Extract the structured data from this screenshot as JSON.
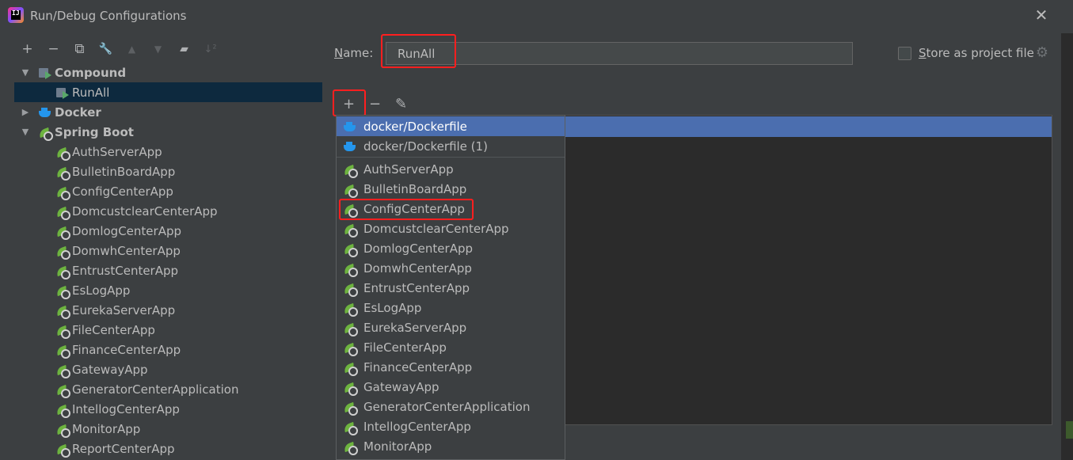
{
  "window": {
    "title": "Run/Debug Configurations"
  },
  "toolbar": {
    "add": "+",
    "remove": "−",
    "copy": "⧉",
    "edit": "🔧",
    "up": "▲",
    "down": "▼",
    "folder": "▰",
    "sort": "↓²"
  },
  "tree": {
    "groups": [
      {
        "label": "Compound",
        "expanded": true,
        "icon": "compound-icon",
        "items": [
          "RunAll"
        ]
      },
      {
        "label": "Docker",
        "expanded": false,
        "icon": "docker-icon",
        "items": []
      },
      {
        "label": "Spring Boot",
        "expanded": true,
        "icon": "spring-boot-icon",
        "items": [
          "AuthServerApp",
          "BulletinBoardApp",
          "ConfigCenterApp",
          "DomcustclearCenterApp",
          "DomlogCenterApp",
          "DomwhCenterApp",
          "EntrustCenterApp",
          "EsLogApp",
          "EurekaServerApp",
          "FileCenterApp",
          "FinanceCenterApp",
          "GatewayApp",
          "GeneratorCenterApplication",
          "IntellogCenterApp",
          "MonitorApp",
          "ReportCenterApp"
        ]
      }
    ]
  },
  "form": {
    "name_label_prefix": "N",
    "name_label_rest": "ame:",
    "name_value": "RunAll",
    "store_label_prefix": "S",
    "store_label_rest": "tore as project file"
  },
  "sub_toolbar": {
    "add": "+",
    "remove": "−",
    "edit": "✎"
  },
  "popup": {
    "docker_items": [
      "docker/Dockerfile",
      "docker/Dockerfile (1)"
    ],
    "spring_items": [
      "AuthServerApp",
      "BulletinBoardApp",
      "ConfigCenterApp",
      "DomcustclearCenterApp",
      "DomlogCenterApp",
      "DomwhCenterApp",
      "EntrustCenterApp",
      "EsLogApp",
      "EurekaServerApp",
      "FileCenterApp",
      "FinanceCenterApp",
      "GatewayApp",
      "GeneratorCenterApplication",
      "IntellogCenterApp",
      "MonitorApp"
    ]
  },
  "colors": {
    "background": "#3c3f41",
    "selection": "#4b6eaf",
    "tree_selection": "#0d293e",
    "highlight_box": "#ff1f1f",
    "spring_green": "#6db33f",
    "docker_blue": "#2496ed"
  }
}
